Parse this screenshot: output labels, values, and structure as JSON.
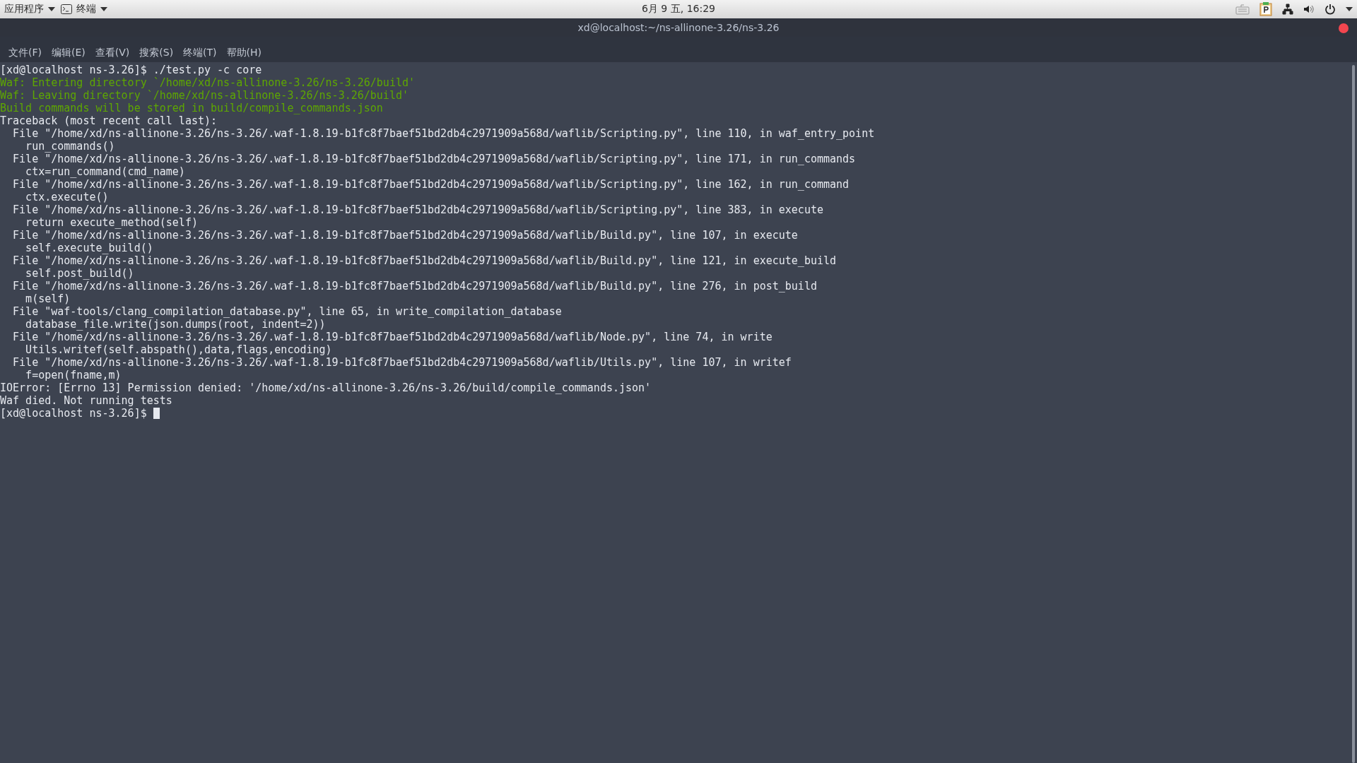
{
  "top_panel": {
    "applications_menu": "应用程序",
    "active_app": "终端",
    "clock": "6月  9 五, 16:29"
  },
  "window": {
    "title": "xd@localhost:~/ns-allinone-3.26/ns-3.26"
  },
  "menu": [
    "文件(F)",
    "编辑(E)",
    "查看(V)",
    "搜索(S)",
    "终端(T)",
    "帮助(H)"
  ],
  "terminal": {
    "lines": [
      {
        "kind": "normal",
        "text": "[xd@localhost ns-3.26]$ ./test.py -c core"
      },
      {
        "kind": "green",
        "text": "Waf: Entering directory `/home/xd/ns-allinone-3.26/ns-3.26/build'"
      },
      {
        "kind": "green",
        "text": "Waf: Leaving directory `/home/xd/ns-allinone-3.26/ns-3.26/build'"
      },
      {
        "kind": "green",
        "text": "Build commands will be stored in build/compile_commands.json"
      },
      {
        "kind": "normal",
        "text": "Traceback (most recent call last):"
      },
      {
        "kind": "normal",
        "text": "  File \"/home/xd/ns-allinone-3.26/ns-3.26/.waf-1.8.19-b1fc8f7baef51bd2db4c2971909a568d/waflib/Scripting.py\", line 110, in waf_entry_point"
      },
      {
        "kind": "normal",
        "text": "    run_commands()"
      },
      {
        "kind": "normal",
        "text": "  File \"/home/xd/ns-allinone-3.26/ns-3.26/.waf-1.8.19-b1fc8f7baef51bd2db4c2971909a568d/waflib/Scripting.py\", line 171, in run_commands"
      },
      {
        "kind": "normal",
        "text": "    ctx=run_command(cmd_name)"
      },
      {
        "kind": "normal",
        "text": "  File \"/home/xd/ns-allinone-3.26/ns-3.26/.waf-1.8.19-b1fc8f7baef51bd2db4c2971909a568d/waflib/Scripting.py\", line 162, in run_command"
      },
      {
        "kind": "normal",
        "text": "    ctx.execute()"
      },
      {
        "kind": "normal",
        "text": "  File \"/home/xd/ns-allinone-3.26/ns-3.26/.waf-1.8.19-b1fc8f7baef51bd2db4c2971909a568d/waflib/Scripting.py\", line 383, in execute"
      },
      {
        "kind": "normal",
        "text": "    return execute_method(self)"
      },
      {
        "kind": "normal",
        "text": "  File \"/home/xd/ns-allinone-3.26/ns-3.26/.waf-1.8.19-b1fc8f7baef51bd2db4c2971909a568d/waflib/Build.py\", line 107, in execute"
      },
      {
        "kind": "normal",
        "text": "    self.execute_build()"
      },
      {
        "kind": "normal",
        "text": "  File \"/home/xd/ns-allinone-3.26/ns-3.26/.waf-1.8.19-b1fc8f7baef51bd2db4c2971909a568d/waflib/Build.py\", line 121, in execute_build"
      },
      {
        "kind": "normal",
        "text": "    self.post_build()"
      },
      {
        "kind": "normal",
        "text": "  File \"/home/xd/ns-allinone-3.26/ns-3.26/.waf-1.8.19-b1fc8f7baef51bd2db4c2971909a568d/waflib/Build.py\", line 276, in post_build"
      },
      {
        "kind": "normal",
        "text": "    m(self)"
      },
      {
        "kind": "normal",
        "text": "  File \"waf-tools/clang_compilation_database.py\", line 65, in write_compilation_database"
      },
      {
        "kind": "normal",
        "text": "    database_file.write(json.dumps(root, indent=2))"
      },
      {
        "kind": "normal",
        "text": "  File \"/home/xd/ns-allinone-3.26/ns-3.26/.waf-1.8.19-b1fc8f7baef51bd2db4c2971909a568d/waflib/Node.py\", line 74, in write"
      },
      {
        "kind": "normal",
        "text": "    Utils.writef(self.abspath(),data,flags,encoding)"
      },
      {
        "kind": "normal",
        "text": "  File \"/home/xd/ns-allinone-3.26/ns-3.26/.waf-1.8.19-b1fc8f7baef51bd2db4c2971909a568d/waflib/Utils.py\", line 107, in writef"
      },
      {
        "kind": "normal",
        "text": "    f=open(fname,m)"
      },
      {
        "kind": "normal",
        "text": "IOError: [Errno 13] Permission denied: '/home/xd/ns-allinone-3.26/ns-3.26/build/compile_commands.json'"
      },
      {
        "kind": "normal",
        "text": "Waf died. Not running tests"
      }
    ],
    "prompt": "[xd@localhost ns-3.26]$"
  }
}
